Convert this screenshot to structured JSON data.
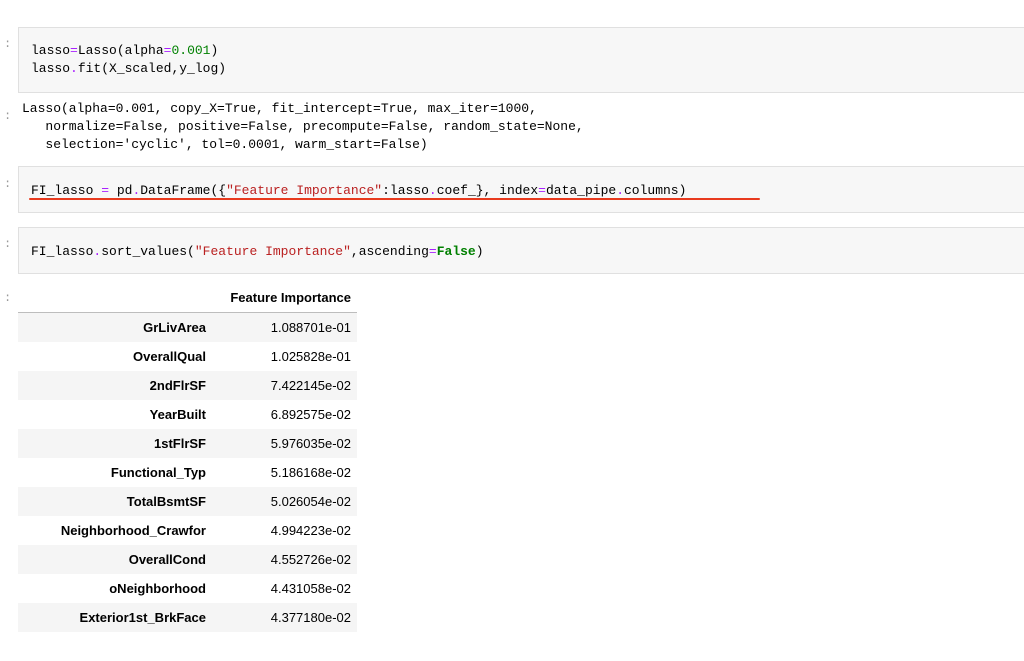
{
  "cells": {
    "cell1": {
      "line1": "lasso=Lasso(alpha=0.001)",
      "line2": "lasso.fit(X_scaled,y_log)"
    },
    "output1": {
      "line1": "Lasso(alpha=0.001, copy_X=True, fit_intercept=True, max_iter=1000,",
      "line2": "   normalize=False, positive=False, precompute=False, random_state=None,",
      "line3": "   selection='cyclic', tol=0.0001, warm_start=False)"
    },
    "cell2": {
      "line1": "FI_lasso = pd.DataFrame({\"Feature Importance\":lasso.coef_}, index=data_pipe.columns)"
    },
    "cell3": {
      "line1": "FI_lasso.sort_values(\"Feature Importance\",ascending=False)"
    }
  },
  "prompt_mark": ":",
  "table": {
    "column_header": "Feature Importance",
    "rows": [
      {
        "index": "GrLivArea",
        "value": "1.088701e-01"
      },
      {
        "index": "OverallQual",
        "value": "1.025828e-01"
      },
      {
        "index": "2ndFlrSF",
        "value": "7.422145e-02"
      },
      {
        "index": "YearBuilt",
        "value": "6.892575e-02"
      },
      {
        "index": "1stFlrSF",
        "value": "5.976035e-02"
      },
      {
        "index": "Functional_Typ",
        "value": "5.186168e-02"
      },
      {
        "index": "TotalBsmtSF",
        "value": "5.026054e-02"
      },
      {
        "index": "Neighborhood_Crawfor",
        "value": "4.994223e-02"
      },
      {
        "index": "OverallCond",
        "value": "4.552726e-02"
      },
      {
        "index": "oNeighborhood",
        "value": "4.431058e-02"
      },
      {
        "index": "Exterior1st_BrkFace",
        "value": "4.377180e-02"
      },
      {
        "index": "",
        "value": ""
      }
    ]
  },
  "colors": {
    "underline": "#e83a1e",
    "keyword_green": "#008000",
    "string_red": "#ba2121",
    "operator_purple": "#aa22ff"
  }
}
